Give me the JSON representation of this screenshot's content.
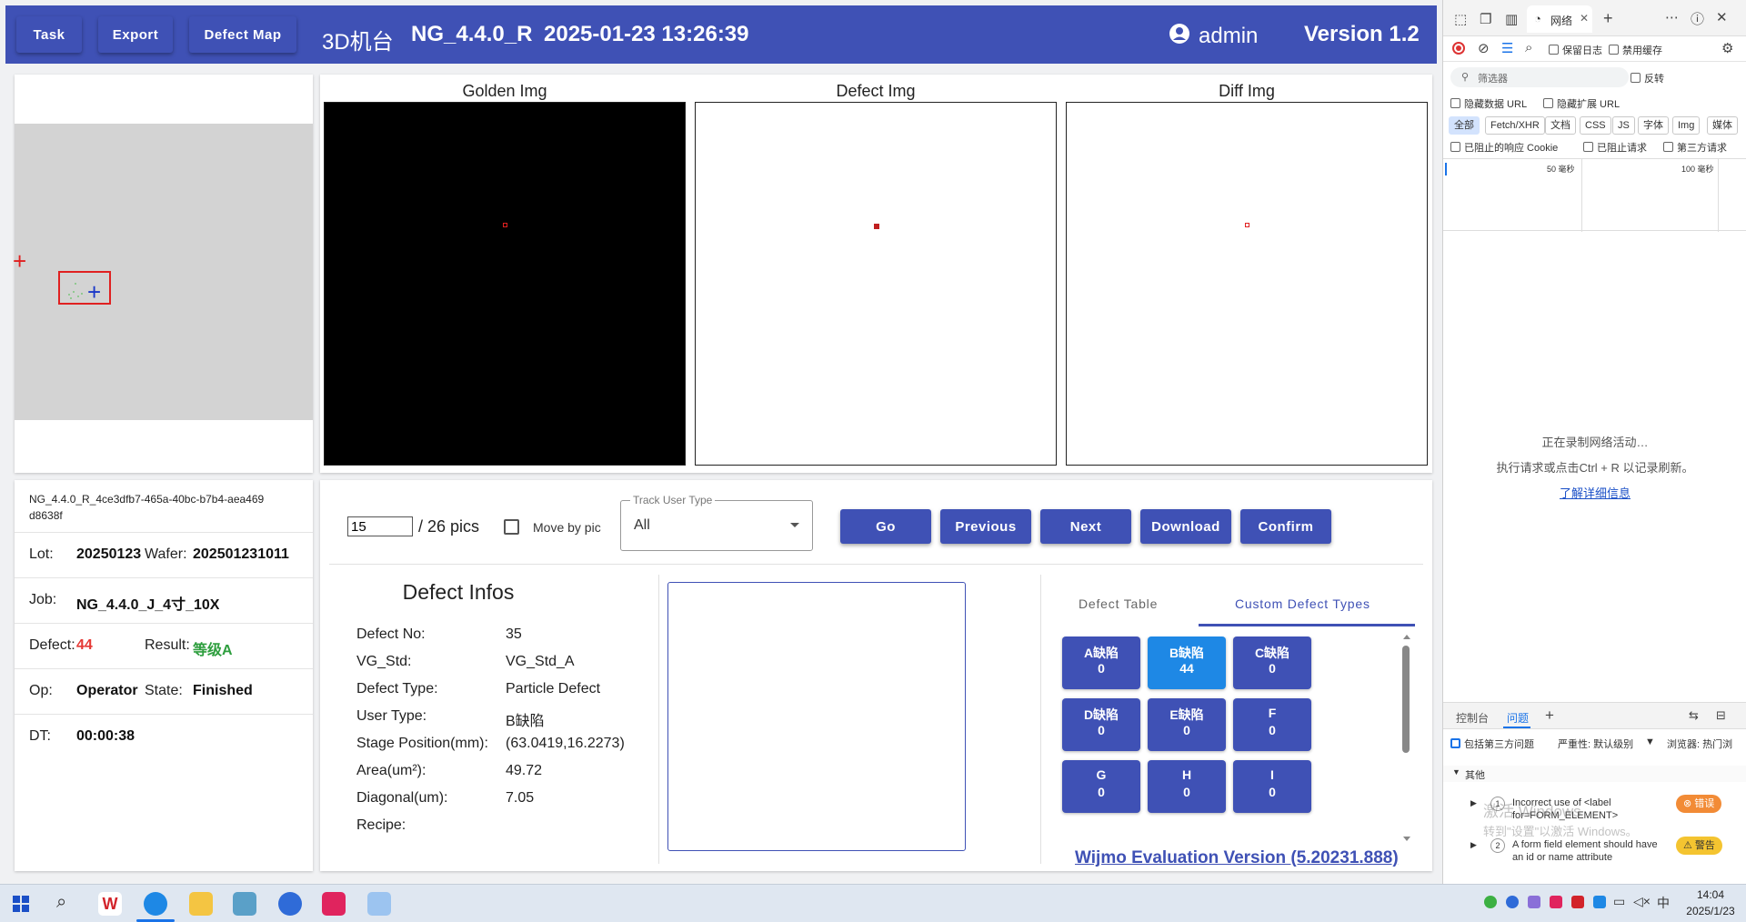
{
  "header": {
    "task_label": "Task",
    "export_label": "Export",
    "defect_map_label": "Defect Map",
    "machine": "3D机台",
    "recipe": "NG_4.4.0_R",
    "datetime": "2025-01-23 13:26:39",
    "user": "admin",
    "version": "Version 1.2"
  },
  "images": {
    "golden_title": "Golden Img",
    "defect_title": "Defect Img",
    "diff_title": "Diff Img"
  },
  "info": {
    "file_id": "NG_4.4.0_R_4ce3dfb7-465a-40bc-b7b4-aea469d8638f",
    "lot_label": "Lot:",
    "lot_value": "20250123",
    "wafer_label": "Wafer:",
    "wafer_value": "202501231011",
    "job_label": "Job:",
    "job_value": "NG_4.4.0_J_4寸_10X",
    "defect_label": "Defect:",
    "defect_value": "44",
    "result_label": "Result:",
    "result_value": "等级A",
    "op_label": "Op:",
    "op_value": "Operator",
    "state_label": "State:",
    "state_value": "Finished",
    "dt_label": "DT:",
    "dt_value": "00:00:38"
  },
  "controls": {
    "page_value": "15",
    "total_text": "/ 26 pics",
    "move_by_pic": "Move by pic",
    "track_label": "Track User Type",
    "track_value": "All",
    "go": "Go",
    "previous": "Previous",
    "next": "Next",
    "download": "Download",
    "confirm": "Confirm"
  },
  "defect_infos": {
    "title": "Defect Infos",
    "rows": [
      {
        "label": "Defect No:",
        "value": "35"
      },
      {
        "label": "VG_Std:",
        "value": "VG_Std_A"
      },
      {
        "label": "Defect Type:",
        "value": "Particle Defect"
      },
      {
        "label": "User Type:",
        "value": "B缺陷"
      },
      {
        "label": "Stage Position(mm):",
        "value": "(63.0419,16.2273)"
      },
      {
        "label": "Area(um²):",
        "value": "49.72"
      },
      {
        "label": "Diagonal(um):",
        "value": "7.05"
      },
      {
        "label": "Recipe:",
        "value": ""
      }
    ]
  },
  "tabs": {
    "defect_table": "Defect Table",
    "custom_types": "Custom Defect Types"
  },
  "types": [
    {
      "name": "A缺陷",
      "count": "0"
    },
    {
      "name": "B缺陷",
      "count": "44"
    },
    {
      "name": "C缺陷",
      "count": "0"
    },
    {
      "name": "D缺陷",
      "count": "0"
    },
    {
      "name": "E缺陷",
      "count": "0"
    },
    {
      "name": "F",
      "count": "0"
    },
    {
      "name": "G",
      "count": "0"
    },
    {
      "name": "H",
      "count": "0"
    },
    {
      "name": "I",
      "count": "0"
    }
  ],
  "wijmo": "Wijmo Evaluation Version (5.20231.888)",
  "devtools": {
    "network_tab": "网络",
    "preserve_log": "保留日志",
    "disable_cache": "禁用缓存",
    "filter_placeholder": "筛选器",
    "invert": "反转",
    "hide_data_url": "隐藏数据 URL",
    "hide_ext_url": "隐藏扩展 URL",
    "chips": [
      "全部",
      "Fetch/XHR",
      "文档",
      "CSS",
      "JS",
      "字体",
      "Img",
      "媒体"
    ],
    "blocked_cookie": "已阻止的响应 Cookie",
    "blocked_requests": "已阻止请求",
    "third_party": "第三方请求",
    "timeline_50": "50 毫秒",
    "timeline_100": "100 毫秒",
    "recording": "正在录制网络活动…",
    "hint": "执行请求或点击Ctrl + R 以记录刷新。",
    "learn_more": "了解详细信息",
    "console_tab": "控制台",
    "issues_tab": "问题",
    "include_third": "包括第三方问题",
    "severity": "严重性: 默认级别",
    "browser": "浏览器: 热门浏",
    "other": "其他",
    "issue1_count": "1",
    "issue1_text": "Incorrect use of <label for=FORM_ELEMENT>",
    "issue1_badge": "错误",
    "issue2_count": "2",
    "issue2_text": "A form field element should have an id or name attribute",
    "issue2_badge": "警告",
    "watermark1": "激活 Windows",
    "watermark2": "转到\"设置\"以激活 Windows。"
  },
  "taskbar": {
    "time": "14:04",
    "date": "2025/1/23"
  },
  "colors": {
    "primary": "#3f51b5",
    "type_button": "#1e88e5",
    "defect_count": "#e53935",
    "result_ok": "#2e9e3e"
  }
}
